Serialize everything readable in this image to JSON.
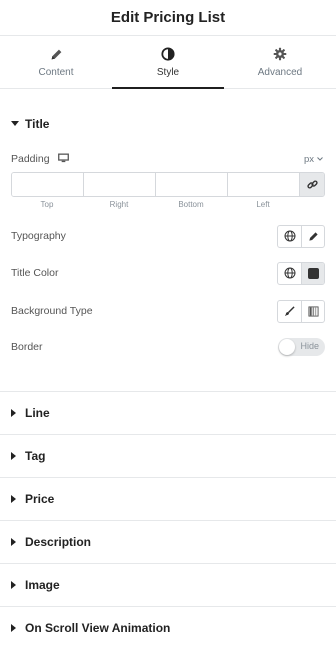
{
  "header": {
    "title": "Edit Pricing List"
  },
  "tabs": [
    {
      "label": "Content",
      "icon": "pencil-icon"
    },
    {
      "label": "Style",
      "icon": "contrast-icon",
      "active": true
    },
    {
      "label": "Advanced",
      "icon": "gear-icon"
    }
  ],
  "title_section": {
    "label": "Title",
    "padding": {
      "label": "Padding",
      "unit": "px",
      "fields": [
        {
          "label": "Top",
          "value": ""
        },
        {
          "label": "Right",
          "value": ""
        },
        {
          "label": "Bottom",
          "value": ""
        },
        {
          "label": "Left",
          "value": ""
        }
      ]
    },
    "typography": {
      "label": "Typography"
    },
    "title_color": {
      "label": "Title Color"
    },
    "background_type": {
      "label": "Background Type"
    },
    "border": {
      "label": "Border",
      "toggle_text": "Hide"
    }
  },
  "collapsed_sections": [
    {
      "label": "Line"
    },
    {
      "label": "Tag"
    },
    {
      "label": "Price"
    },
    {
      "label": "Description"
    },
    {
      "label": "Image"
    },
    {
      "label": "On Scroll View Animation"
    }
  ],
  "colors": {
    "accent_dark": "#1f1f1f",
    "divider": "#e6e8ea",
    "muted_text": "#6d7882"
  }
}
